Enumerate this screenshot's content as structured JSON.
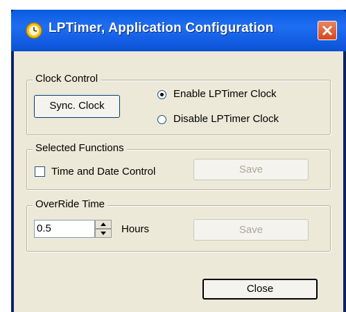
{
  "window": {
    "title": "LPTimer, Application Configuration",
    "icon": "clock-icon",
    "close_icon": "close-icon"
  },
  "clock_control": {
    "legend": "Clock Control",
    "sync_button": "Sync. Clock",
    "enable_label": "Enable LPTimer Clock",
    "disable_label": "Disable LPTimer Clock",
    "selected": "enable"
  },
  "selected_functions": {
    "legend": "Selected Functions",
    "checkbox_label": "Time and Date Control",
    "checked": false,
    "save_button": "Save"
  },
  "override_time": {
    "legend": "OverRide Time",
    "value": "0.5",
    "unit_label": "Hours",
    "save_button": "Save"
  },
  "footer": {
    "close_button": "Close"
  },
  "colors": {
    "titlebar": "#0b5be0",
    "dialog_bg": "#ece9d8",
    "close_button": "#d5471c"
  }
}
